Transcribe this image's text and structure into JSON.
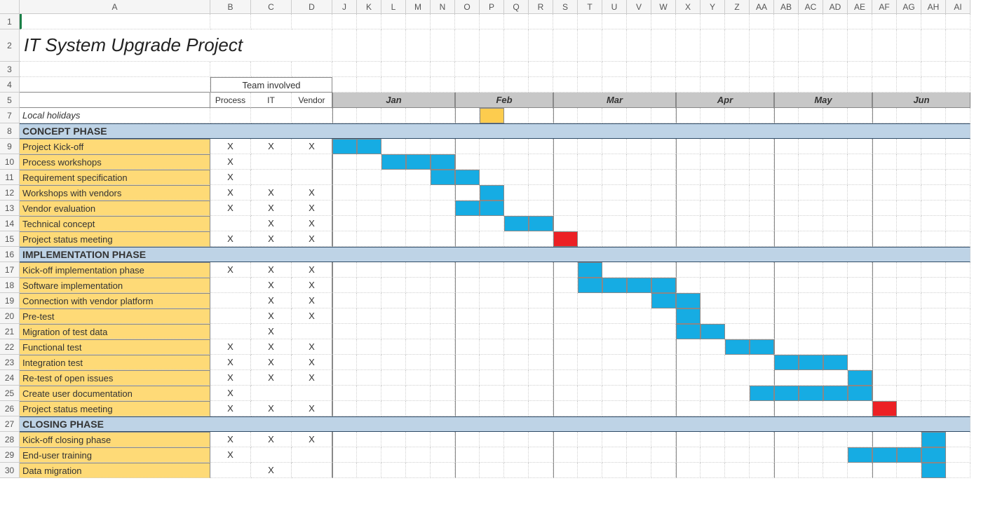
{
  "title": "IT System Upgrade Project",
  "teamHeader": "Team involved",
  "teamCols": [
    "Process",
    "IT",
    "Vendor"
  ],
  "months": [
    "Jan",
    "Feb",
    "Mar",
    "Apr",
    "May",
    "Jun"
  ],
  "monthStarts": [
    0,
    5,
    9,
    14,
    18,
    22
  ],
  "holidaysLabel": "Local holidays",
  "holidayWeeks": [
    6
  ],
  "phases": [
    {
      "name": "CONCEPT PHASE",
      "tasks": [
        {
          "name": "Project Kick-off",
          "team": [
            "X",
            "X",
            "X"
          ],
          "bars": [
            {
              "start": 0,
              "end": 1,
              "color": "blue"
            }
          ]
        },
        {
          "name": "Process workshops",
          "team": [
            "X",
            "",
            ""
          ],
          "bars": [
            {
              "start": 2,
              "end": 4,
              "color": "blue"
            }
          ]
        },
        {
          "name": "Requirement specification",
          "team": [
            "X",
            "",
            ""
          ],
          "bars": [
            {
              "start": 4,
              "end": 5,
              "color": "blue"
            }
          ]
        },
        {
          "name": "Workshops with vendors",
          "team": [
            "X",
            "X",
            "X"
          ],
          "bars": [
            {
              "start": 6,
              "end": 6,
              "color": "blue"
            }
          ]
        },
        {
          "name": "Vendor evaluation",
          "team": [
            "X",
            "X",
            "X"
          ],
          "bars": [
            {
              "start": 5,
              "end": 6,
              "color": "blue"
            }
          ]
        },
        {
          "name": "Technical concept",
          "team": [
            "",
            "X",
            "X"
          ],
          "bars": [
            {
              "start": 7,
              "end": 8,
              "color": "blue"
            }
          ]
        },
        {
          "name": "Project status meeting",
          "team": [
            "X",
            "X",
            "X"
          ],
          "bars": [
            {
              "start": 9,
              "end": 9,
              "color": "red"
            }
          ]
        }
      ]
    },
    {
      "name": "IMPLEMENTATION PHASE",
      "tasks": [
        {
          "name": "Kick-off implementation phase",
          "team": [
            "X",
            "X",
            "X"
          ],
          "bars": [
            {
              "start": 10,
              "end": 10,
              "color": "blue"
            }
          ]
        },
        {
          "name": "Software implementation",
          "team": [
            "",
            "X",
            "X"
          ],
          "bars": [
            {
              "start": 10,
              "end": 13,
              "color": "blue"
            }
          ]
        },
        {
          "name": "Connection with vendor platform",
          "team": [
            "",
            "X",
            "X"
          ],
          "bars": [
            {
              "start": 13,
              "end": 14,
              "color": "blue"
            }
          ]
        },
        {
          "name": "Pre-test",
          "team": [
            "",
            "X",
            "X"
          ],
          "bars": [
            {
              "start": 14,
              "end": 14,
              "color": "blue"
            }
          ]
        },
        {
          "name": "Migration of test data",
          "team": [
            "",
            "X",
            ""
          ],
          "bars": [
            {
              "start": 14,
              "end": 15,
              "color": "blue"
            }
          ]
        },
        {
          "name": "Functional test",
          "team": [
            "X",
            "X",
            "X"
          ],
          "bars": [
            {
              "start": 16,
              "end": 17,
              "color": "blue"
            }
          ]
        },
        {
          "name": "Integration test",
          "team": [
            "X",
            "X",
            "X"
          ],
          "bars": [
            {
              "start": 18,
              "end": 20,
              "color": "blue"
            }
          ]
        },
        {
          "name": "Re-test of open issues",
          "team": [
            "X",
            "X",
            "X"
          ],
          "bars": [
            {
              "start": 21,
              "end": 21,
              "color": "blue"
            }
          ]
        },
        {
          "name": "Create user documentation",
          "team": [
            "X",
            "",
            ""
          ],
          "bars": [
            {
              "start": 17,
              "end": 21,
              "color": "blue"
            }
          ]
        },
        {
          "name": "Project status meeting",
          "team": [
            "X",
            "X",
            "X"
          ],
          "bars": [
            {
              "start": 22,
              "end": 22,
              "color": "red"
            }
          ]
        }
      ]
    },
    {
      "name": "CLOSING PHASE",
      "tasks": [
        {
          "name": "Kick-off closing phase",
          "team": [
            "X",
            "X",
            "X"
          ],
          "bars": [
            {
              "start": 24,
              "end": 24,
              "color": "blue"
            }
          ]
        },
        {
          "name": "End-user training",
          "team": [
            "X",
            "",
            ""
          ],
          "bars": [
            {
              "start": 21,
              "end": 24,
              "color": "blue"
            }
          ]
        },
        {
          "name": "Data migration",
          "team": [
            "",
            "X",
            ""
          ],
          "bars": [
            {
              "start": 24,
              "end": 24,
              "color": "blue"
            }
          ]
        }
      ]
    }
  ],
  "chart_data": {
    "type": "gantt",
    "title": "IT System Upgrade Project",
    "time_unit": "week",
    "month_boundaries": {
      "Jan": [
        0,
        4
      ],
      "Feb": [
        5,
        8
      ],
      "Mar": [
        9,
        13
      ],
      "Apr": [
        14,
        17
      ],
      "May": [
        18,
        21
      ],
      "Jun": [
        22,
        25
      ]
    },
    "holidays_weeks": [
      6
    ],
    "series": [
      {
        "name": "Project Kick-off",
        "phase": "Concept",
        "team": [
          "Process",
          "IT",
          "Vendor"
        ],
        "start_week": 0,
        "end_week": 1
      },
      {
        "name": "Process workshops",
        "phase": "Concept",
        "team": [
          "Process"
        ],
        "start_week": 2,
        "end_week": 4
      },
      {
        "name": "Requirement specification",
        "phase": "Concept",
        "team": [
          "Process"
        ],
        "start_week": 4,
        "end_week": 5
      },
      {
        "name": "Workshops with vendors",
        "phase": "Concept",
        "team": [
          "Process",
          "IT",
          "Vendor"
        ],
        "start_week": 6,
        "end_week": 6
      },
      {
        "name": "Vendor evaluation",
        "phase": "Concept",
        "team": [
          "Process",
          "IT",
          "Vendor"
        ],
        "start_week": 5,
        "end_week": 6
      },
      {
        "name": "Technical concept",
        "phase": "Concept",
        "team": [
          "IT",
          "Vendor"
        ],
        "start_week": 7,
        "end_week": 8
      },
      {
        "name": "Project status meeting",
        "phase": "Concept",
        "team": [
          "Process",
          "IT",
          "Vendor"
        ],
        "start_week": 9,
        "end_week": 9,
        "milestone": true
      },
      {
        "name": "Kick-off implementation phase",
        "phase": "Implementation",
        "team": [
          "Process",
          "IT",
          "Vendor"
        ],
        "start_week": 10,
        "end_week": 10
      },
      {
        "name": "Software implementation",
        "phase": "Implementation",
        "team": [
          "IT",
          "Vendor"
        ],
        "start_week": 10,
        "end_week": 13
      },
      {
        "name": "Connection with vendor platform",
        "phase": "Implementation",
        "team": [
          "IT",
          "Vendor"
        ],
        "start_week": 13,
        "end_week": 14
      },
      {
        "name": "Pre-test",
        "phase": "Implementation",
        "team": [
          "IT",
          "Vendor"
        ],
        "start_week": 14,
        "end_week": 14
      },
      {
        "name": "Migration of test data",
        "phase": "Implementation",
        "team": [
          "IT"
        ],
        "start_week": 14,
        "end_week": 15
      },
      {
        "name": "Functional test",
        "phase": "Implementation",
        "team": [
          "Process",
          "IT",
          "Vendor"
        ],
        "start_week": 16,
        "end_week": 17
      },
      {
        "name": "Integration test",
        "phase": "Implementation",
        "team": [
          "Process",
          "IT",
          "Vendor"
        ],
        "start_week": 18,
        "end_week": 20
      },
      {
        "name": "Re-test of open issues",
        "phase": "Implementation",
        "team": [
          "Process",
          "IT",
          "Vendor"
        ],
        "start_week": 21,
        "end_week": 21
      },
      {
        "name": "Create user documentation",
        "phase": "Implementation",
        "team": [
          "Process"
        ],
        "start_week": 17,
        "end_week": 21
      },
      {
        "name": "Project status meeting",
        "phase": "Implementation",
        "team": [
          "Process",
          "IT",
          "Vendor"
        ],
        "start_week": 22,
        "end_week": 22,
        "milestone": true
      },
      {
        "name": "Kick-off closing phase",
        "phase": "Closing",
        "team": [
          "Process",
          "IT",
          "Vendor"
        ],
        "start_week": 24,
        "end_week": 24
      },
      {
        "name": "End-user training",
        "phase": "Closing",
        "team": [
          "Process"
        ],
        "start_week": 21,
        "end_week": 24
      },
      {
        "name": "Data migration",
        "phase": "Closing",
        "team": [
          "IT"
        ],
        "start_week": 24,
        "end_week": 24
      }
    ]
  }
}
